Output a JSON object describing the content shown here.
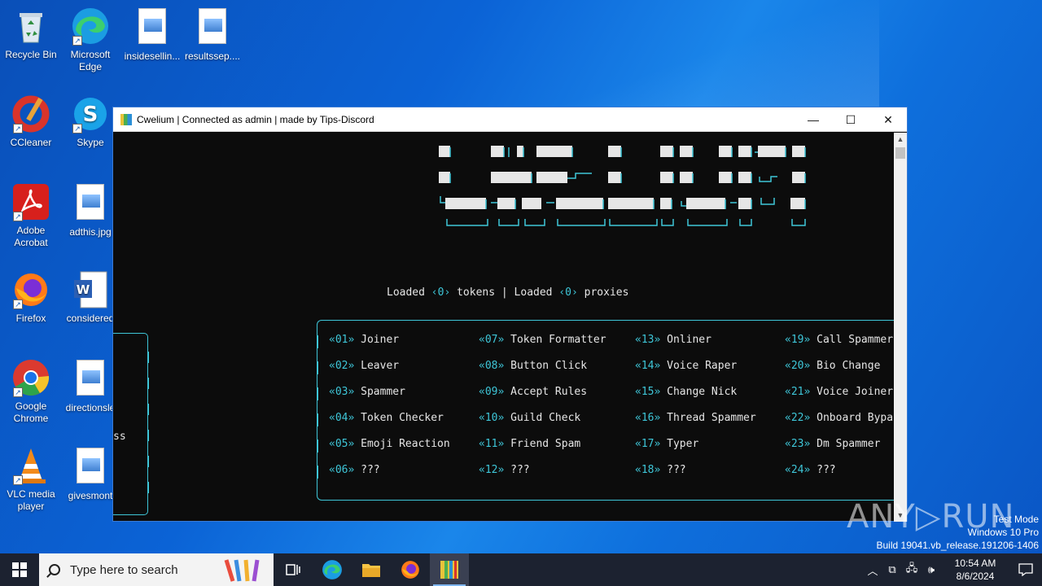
{
  "desktop": {
    "icons": [
      {
        "label": "Recycle Bin"
      },
      {
        "label": "Microsoft Edge"
      },
      {
        "label": "insidesellin..."
      },
      {
        "label": "resultssep...."
      },
      {
        "label": "CCleaner"
      },
      {
        "label": "Skype"
      },
      {
        "label": "Adobe Acrobat"
      },
      {
        "label": "adthis.jpg"
      },
      {
        "label": "Firefox"
      },
      {
        "label": "considered"
      },
      {
        "label": "Google Chrome"
      },
      {
        "label": "directionsle"
      },
      {
        "label": "VLC media player"
      },
      {
        "label": "givesmont"
      }
    ]
  },
  "window": {
    "title": "Cwelium | Connected as admin | made by Tips-Discord",
    "minimize": "—",
    "maximize": "☐",
    "close": "✕"
  },
  "console": {
    "loaded_prefix": "Loaded ",
    "tokens_count": "‹0›",
    "tokens_word": " tokens | Loaded ",
    "proxies_count": "‹0›",
    "proxies_word": " proxies",
    "side_text": "ss",
    "prompt": "->",
    "menu": [
      {
        "num": "«01»",
        "label": "Joiner"
      },
      {
        "num": "«02»",
        "label": "Leaver"
      },
      {
        "num": "«03»",
        "label": "Spammer"
      },
      {
        "num": "«04»",
        "label": "Token Checker"
      },
      {
        "num": "«05»",
        "label": "Emoji Reaction"
      },
      {
        "num": "«06»",
        "label": "???"
      },
      {
        "num": "«07»",
        "label": "Token Formatter"
      },
      {
        "num": "«08»",
        "label": "Button Click"
      },
      {
        "num": "«09»",
        "label": "Accept Rules"
      },
      {
        "num": "«10»",
        "label": "Guild Check"
      },
      {
        "num": "«11»",
        "label": "Friend Spam"
      },
      {
        "num": "«12»",
        "label": "???"
      },
      {
        "num": "«13»",
        "label": "Onliner"
      },
      {
        "num": "«14»",
        "label": "Voice Raper"
      },
      {
        "num": "«15»",
        "label": "Change Nick"
      },
      {
        "num": "«16»",
        "label": "Thread Spammer"
      },
      {
        "num": "«17»",
        "label": "Typer"
      },
      {
        "num": "«18»",
        "label": "???"
      },
      {
        "num": "«19»",
        "label": "Call Spammer"
      },
      {
        "num": "«20»",
        "label": "Bio Change"
      },
      {
        "num": "«21»",
        "label": "Voice Joiner"
      },
      {
        "num": "«22»",
        "label": "Onboard Bypa"
      },
      {
        "num": "«23»",
        "label": "Dm Spammer"
      },
      {
        "num": "«24»",
        "label": "???"
      }
    ]
  },
  "watermark": {
    "brand": "ANY▷RUN",
    "line1": "Test Mode",
    "line2": "Windows 10 Pro",
    "line3": "Build 19041.vb_release.191206-1406"
  },
  "taskbar": {
    "search_placeholder": "Type here to search",
    "time": "10:54 AM",
    "date": "8/6/2024"
  },
  "colors": {
    "accent_cyan": "#3ec6d8",
    "console_bg": "#0c0c0c",
    "desktop_blue": "#0b63d6"
  }
}
